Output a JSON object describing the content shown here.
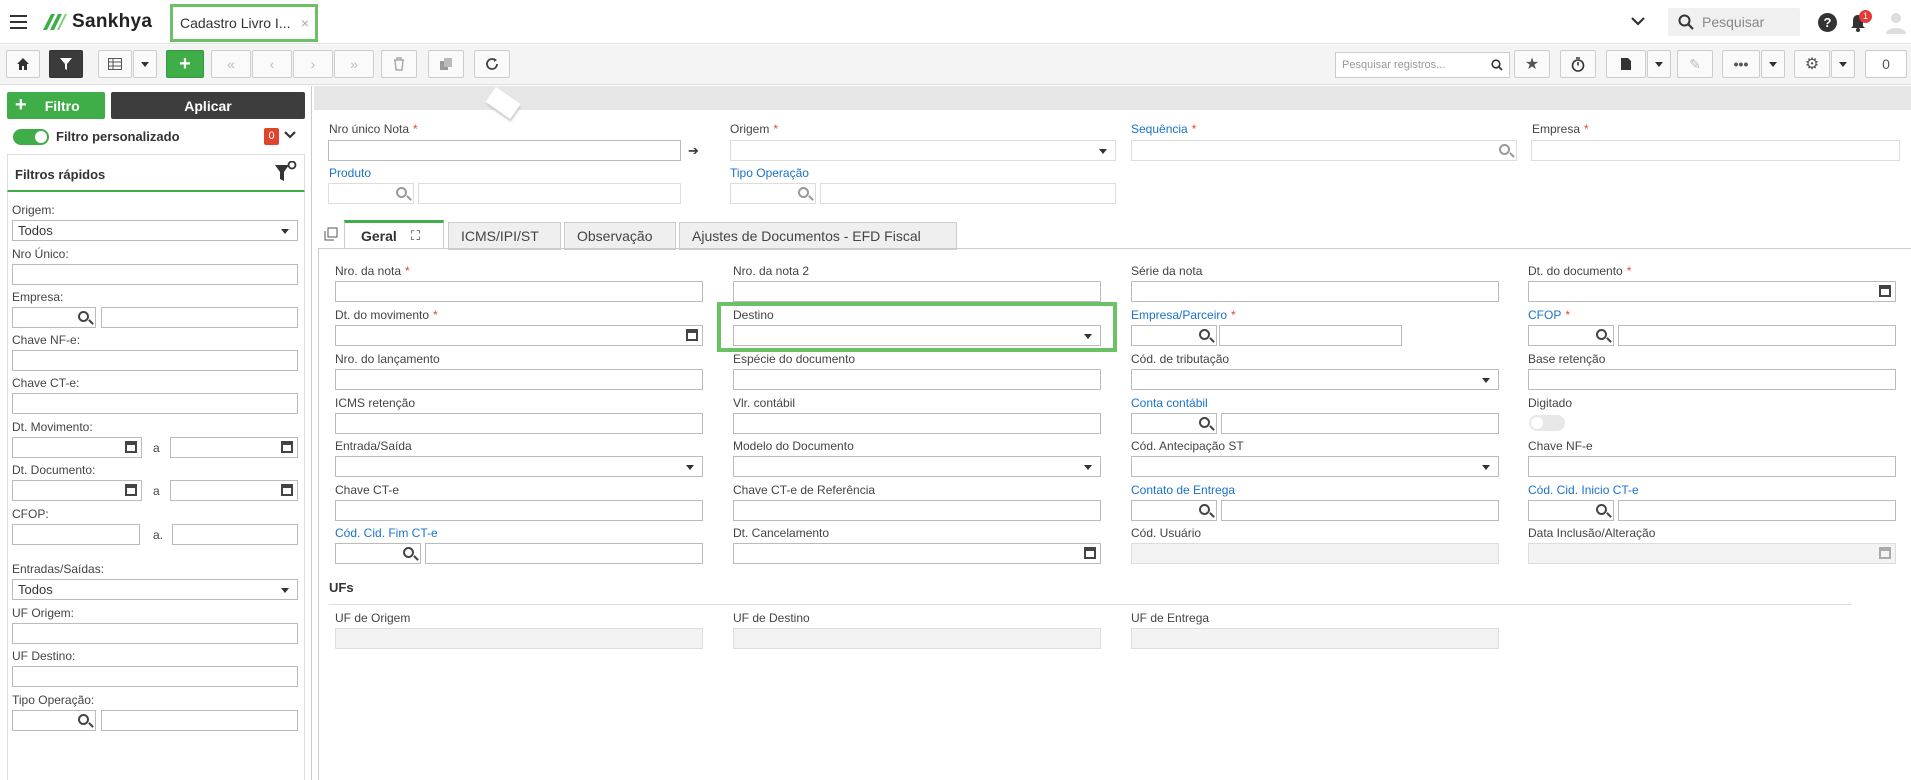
{
  "app": {
    "brand": "Sankhya",
    "tab_title": "Cadastro Livro I...",
    "search_placeholder": "Pesquisar",
    "notif_count": "1"
  },
  "toolbar": {
    "search_placeholder": "Pesquisar registros...",
    "count": "0"
  },
  "left": {
    "filter_btn": "Filtro",
    "apply_btn": "Aplicar",
    "custom_filter": "Filtro personalizado",
    "custom_filter_count": "0",
    "quick_filters": "Filtros rápidos",
    "origem_label": "Origem:",
    "origem_value": "Todos",
    "nro_unico_label": "Nro Único:",
    "empresa_label": "Empresa:",
    "chave_nfe_label": "Chave NF-e:",
    "chave_cte_label": "Chave CT-e:",
    "dt_mov_label": "Dt. Movimento:",
    "dt_doc_label": "Dt. Documento:",
    "a": "a",
    "a2": "a.",
    "cfop_label": "CFOP:",
    "entradas_label": "Entradas/Saídas:",
    "entradas_value": "Todos",
    "uf_origem_label": "UF Origem:",
    "uf_destino_label": "UF Destino:",
    "tipo_op_label": "Tipo Operação:"
  },
  "header": {
    "nro_unico": "Nro único Nota",
    "origem": "Origem",
    "sequencia": "Sequência",
    "empresa": "Empresa",
    "produto": "Produto",
    "tipo_operacao": "Tipo Operação"
  },
  "tabs": [
    "Geral",
    "ICMS/IPI/ST",
    "Observação",
    "Ajustes de Documentos - EFD Fiscal"
  ],
  "form": {
    "nro_nota": "Nro. da nota",
    "nro_nota2": "Nro. da nota 2",
    "serie_nota": "Série da nota",
    "dt_documento": "Dt. do documento",
    "dt_movimento": "Dt. do movimento",
    "destino": "Destino",
    "empresa_parceiro": "Empresa/Parceiro",
    "cfop": "CFOP",
    "nro_lancamento": "Nro. do lançamento",
    "especie_documento": "Espécie do documento",
    "cod_tributacao": "Cód. de tributação",
    "base_retencao": "Base retenção",
    "icms_retencao": "ICMS retenção",
    "vlr_contabil": "Vlr. contábil",
    "conta_contabil": "Conta contábil",
    "digitado": "Digitado",
    "entrada_saida": "Entrada/Saída",
    "modelo_documento": "Modelo do Documento",
    "cod_antecipacao_st": "Cód. Antecipação ST",
    "chave_nfe": "Chave NF-e",
    "chave_cte": "Chave CT-e",
    "chave_cte_ref": "Chave CT-e de Referência",
    "contato_entrega": "Contato de Entrega",
    "cod_cid_inicio_cte": "Cód. Cid. Inicio CT-e",
    "cod_cid_fim_cte": "Cód. Cid. Fim CT-e",
    "dt_cancelamento": "Dt. Cancelamento",
    "cod_usuario": "Cód. Usuário",
    "data_inclusao": "Data Inclusão/Alteração",
    "ufs_section": "UFs",
    "uf_origem": "UF de Origem",
    "uf_destino": "UF de Destino",
    "uf_entrega": "UF de Entrega"
  },
  "colors": {
    "accent": "#3fae49",
    "link": "#1a73c9",
    "required": "#e24b2a",
    "highlight": "#6cc065"
  }
}
